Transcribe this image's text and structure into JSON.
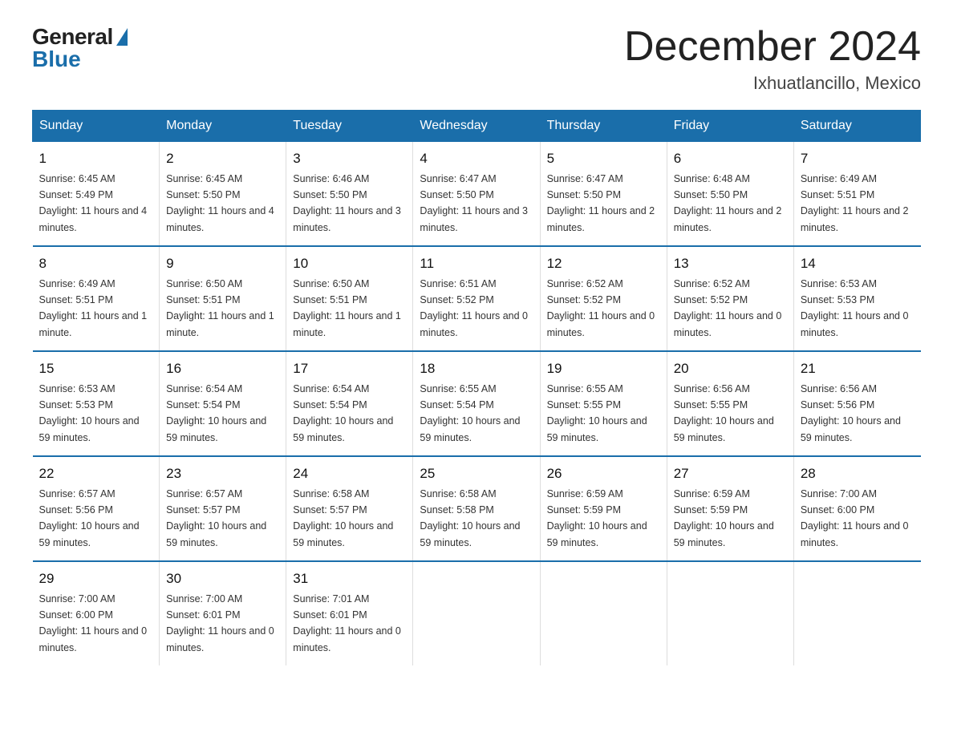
{
  "logo": {
    "general": "General",
    "blue": "Blue"
  },
  "title": "December 2024",
  "location": "Ixhuatlancillo, Mexico",
  "weekdays": [
    "Sunday",
    "Monday",
    "Tuesday",
    "Wednesday",
    "Thursday",
    "Friday",
    "Saturday"
  ],
  "weeks": [
    [
      {
        "day": "1",
        "sunrise": "6:45 AM",
        "sunset": "5:49 PM",
        "daylight": "11 hours and 4 minutes."
      },
      {
        "day": "2",
        "sunrise": "6:45 AM",
        "sunset": "5:50 PM",
        "daylight": "11 hours and 4 minutes."
      },
      {
        "day": "3",
        "sunrise": "6:46 AM",
        "sunset": "5:50 PM",
        "daylight": "11 hours and 3 minutes."
      },
      {
        "day": "4",
        "sunrise": "6:47 AM",
        "sunset": "5:50 PM",
        "daylight": "11 hours and 3 minutes."
      },
      {
        "day": "5",
        "sunrise": "6:47 AM",
        "sunset": "5:50 PM",
        "daylight": "11 hours and 2 minutes."
      },
      {
        "day": "6",
        "sunrise": "6:48 AM",
        "sunset": "5:50 PM",
        "daylight": "11 hours and 2 minutes."
      },
      {
        "day": "7",
        "sunrise": "6:49 AM",
        "sunset": "5:51 PM",
        "daylight": "11 hours and 2 minutes."
      }
    ],
    [
      {
        "day": "8",
        "sunrise": "6:49 AM",
        "sunset": "5:51 PM",
        "daylight": "11 hours and 1 minute."
      },
      {
        "day": "9",
        "sunrise": "6:50 AM",
        "sunset": "5:51 PM",
        "daylight": "11 hours and 1 minute."
      },
      {
        "day": "10",
        "sunrise": "6:50 AM",
        "sunset": "5:51 PM",
        "daylight": "11 hours and 1 minute."
      },
      {
        "day": "11",
        "sunrise": "6:51 AM",
        "sunset": "5:52 PM",
        "daylight": "11 hours and 0 minutes."
      },
      {
        "day": "12",
        "sunrise": "6:52 AM",
        "sunset": "5:52 PM",
        "daylight": "11 hours and 0 minutes."
      },
      {
        "day": "13",
        "sunrise": "6:52 AM",
        "sunset": "5:52 PM",
        "daylight": "11 hours and 0 minutes."
      },
      {
        "day": "14",
        "sunrise": "6:53 AM",
        "sunset": "5:53 PM",
        "daylight": "11 hours and 0 minutes."
      }
    ],
    [
      {
        "day": "15",
        "sunrise": "6:53 AM",
        "sunset": "5:53 PM",
        "daylight": "10 hours and 59 minutes."
      },
      {
        "day": "16",
        "sunrise": "6:54 AM",
        "sunset": "5:54 PM",
        "daylight": "10 hours and 59 minutes."
      },
      {
        "day": "17",
        "sunrise": "6:54 AM",
        "sunset": "5:54 PM",
        "daylight": "10 hours and 59 minutes."
      },
      {
        "day": "18",
        "sunrise": "6:55 AM",
        "sunset": "5:54 PM",
        "daylight": "10 hours and 59 minutes."
      },
      {
        "day": "19",
        "sunrise": "6:55 AM",
        "sunset": "5:55 PM",
        "daylight": "10 hours and 59 minutes."
      },
      {
        "day": "20",
        "sunrise": "6:56 AM",
        "sunset": "5:55 PM",
        "daylight": "10 hours and 59 minutes."
      },
      {
        "day": "21",
        "sunrise": "6:56 AM",
        "sunset": "5:56 PM",
        "daylight": "10 hours and 59 minutes."
      }
    ],
    [
      {
        "day": "22",
        "sunrise": "6:57 AM",
        "sunset": "5:56 PM",
        "daylight": "10 hours and 59 minutes."
      },
      {
        "day": "23",
        "sunrise": "6:57 AM",
        "sunset": "5:57 PM",
        "daylight": "10 hours and 59 minutes."
      },
      {
        "day": "24",
        "sunrise": "6:58 AM",
        "sunset": "5:57 PM",
        "daylight": "10 hours and 59 minutes."
      },
      {
        "day": "25",
        "sunrise": "6:58 AM",
        "sunset": "5:58 PM",
        "daylight": "10 hours and 59 minutes."
      },
      {
        "day": "26",
        "sunrise": "6:59 AM",
        "sunset": "5:59 PM",
        "daylight": "10 hours and 59 minutes."
      },
      {
        "day": "27",
        "sunrise": "6:59 AM",
        "sunset": "5:59 PM",
        "daylight": "10 hours and 59 minutes."
      },
      {
        "day": "28",
        "sunrise": "7:00 AM",
        "sunset": "6:00 PM",
        "daylight": "11 hours and 0 minutes."
      }
    ],
    [
      {
        "day": "29",
        "sunrise": "7:00 AM",
        "sunset": "6:00 PM",
        "daylight": "11 hours and 0 minutes."
      },
      {
        "day": "30",
        "sunrise": "7:00 AM",
        "sunset": "6:01 PM",
        "daylight": "11 hours and 0 minutes."
      },
      {
        "day": "31",
        "sunrise": "7:01 AM",
        "sunset": "6:01 PM",
        "daylight": "11 hours and 0 minutes."
      },
      {
        "day": "",
        "sunrise": "",
        "sunset": "",
        "daylight": ""
      },
      {
        "day": "",
        "sunrise": "",
        "sunset": "",
        "daylight": ""
      },
      {
        "day": "",
        "sunrise": "",
        "sunset": "",
        "daylight": ""
      },
      {
        "day": "",
        "sunrise": "",
        "sunset": "",
        "daylight": ""
      }
    ]
  ]
}
